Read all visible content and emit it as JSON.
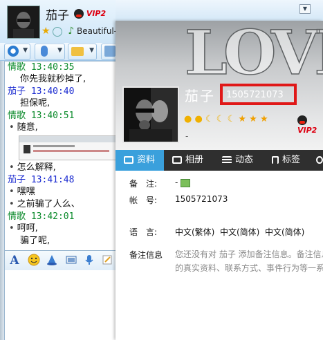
{
  "chat": {
    "contact_name": "茄子",
    "vip_label": "VIP2",
    "status_text": "Beautiful-l",
    "messages": [
      {
        "type": "head",
        "color": "green",
        "sender": "情歌",
        "time": "13:40:35"
      },
      {
        "type": "line",
        "text": "你先我就秒掉了,",
        "bullet": false
      },
      {
        "type": "head",
        "color": "blue",
        "sender": "茄子",
        "time": "13:40:40"
      },
      {
        "type": "line",
        "text": "担保呢,",
        "bullet": false
      },
      {
        "type": "head",
        "color": "green",
        "sender": "情歌",
        "time": "13:40:51"
      },
      {
        "type": "line",
        "text": "随意,",
        "bullet": true
      },
      {
        "type": "image"
      },
      {
        "type": "line",
        "text": "怎么解释,",
        "bullet": true
      },
      {
        "type": "head",
        "color": "blue",
        "sender": "茄子",
        "time": "13:41:48"
      },
      {
        "type": "line",
        "text": "嘿嘿",
        "bullet": true
      },
      {
        "type": "line",
        "text": "之前骗了人么、",
        "bullet": true
      },
      {
        "type": "head",
        "color": "green",
        "sender": "情歌",
        "time": "13:42:01"
      },
      {
        "type": "line",
        "text": "呵呵,",
        "bullet": true
      },
      {
        "type": "line",
        "text": "骗了呢,",
        "bullet": false
      }
    ],
    "tools": [
      "font-icon",
      "emoji-icon",
      "shake-icon",
      "screen-icon",
      "voice-icon",
      "note-icon"
    ]
  },
  "profile": {
    "name": "茄子",
    "qq_number": "1505721073",
    "vip_label": "VIP2",
    "dash": "-",
    "tabs": [
      {
        "label": "资料",
        "active": true
      },
      {
        "label": "相册",
        "active": false
      },
      {
        "label": "动态",
        "active": false
      },
      {
        "label": "标签",
        "active": false
      }
    ],
    "fields": {
      "remark_label": "备　注:",
      "remark_value": "-",
      "account_label": "帐　号:",
      "account_value": "1505721073",
      "language_label": "语　言:",
      "language_value": "中文(繁体)  中文(简体)  中文(简体)",
      "remark_info_label": "备注信息",
      "remark_info_value_1": "您还没有对 茄子 添加备注信息。备注信息",
      "remark_info_value_2": "的真实资料、联系方式、事件行为等一系"
    }
  },
  "colors": {
    "highlight": "#e01818",
    "tab_active": "#3aa0dc",
    "tab_bar": "#2f2f2f",
    "sender_green": "#0a8a2a",
    "sender_blue": "#1a2ad0"
  }
}
